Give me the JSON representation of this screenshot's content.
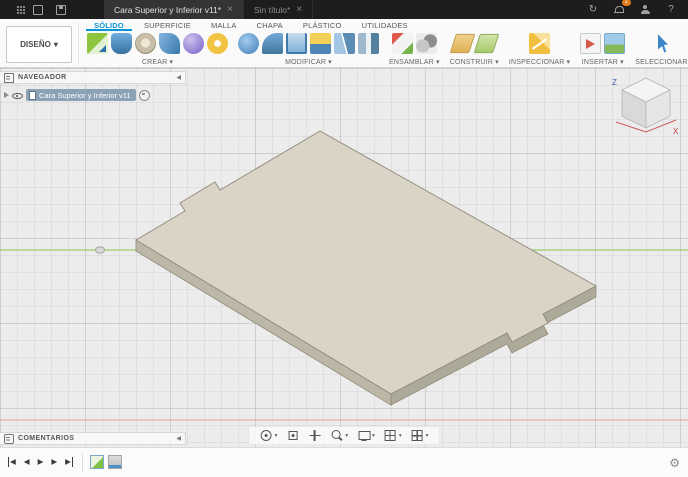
{
  "titlebar": {
    "left_icons": [
      "apps-grid",
      "data-panel",
      "save"
    ],
    "tabs": [
      {
        "label": "Cara Superior y Inferior v11*",
        "active": true
      },
      {
        "label": "Sin título*",
        "active": false
      }
    ],
    "close_symbol": "×",
    "right_icons": [
      {
        "name": "sync-history",
        "symbol": "↻"
      },
      {
        "name": "notifications",
        "symbol": "",
        "badge": "1"
      },
      {
        "name": "profile",
        "symbol": ""
      },
      {
        "name": "help",
        "symbol": "?"
      }
    ]
  },
  "toolbar": {
    "workspace_button": {
      "label": "DISEÑO",
      "arrow": "▾"
    },
    "ribbon_tabs": [
      {
        "label": "SÓLIDO",
        "active": true
      },
      {
        "label": "SUPERFICIE",
        "active": false
      },
      {
        "label": "MALLA",
        "active": false
      },
      {
        "label": "CHAPA",
        "active": false
      },
      {
        "label": "PLÁSTICO",
        "active": false
      },
      {
        "label": "UTILIDADES",
        "active": false
      }
    ],
    "groups": [
      {
        "label": "CREAR",
        "arrow": "▾",
        "icons": [
          "create-sketch",
          "extrude",
          "revolve",
          "sweep",
          "sphere",
          "coil"
        ]
      },
      {
        "label": "MODIFICAR",
        "arrow": "▾",
        "icons": [
          "press-pull",
          "fillet",
          "shell",
          "combine",
          "split-body",
          "align"
        ]
      },
      {
        "label": "ENSAMBLAR",
        "arrow": "▾",
        "icons": [
          "new-component",
          "joint"
        ]
      },
      {
        "label": "CONSTRUIR",
        "arrow": "▾",
        "icons": [
          "offset-plane",
          "axis"
        ]
      },
      {
        "label": "INSPECCIONAR",
        "arrow": "▾",
        "icons": [
          "measure"
        ]
      },
      {
        "label": "INSERTAR",
        "arrow": "▾",
        "icons": [
          "insert-derive",
          "decal"
        ]
      },
      {
        "label": "SELECCIONAR",
        "arrow": "▾",
        "icons": [
          "select"
        ]
      }
    ]
  },
  "navigator": {
    "title": "NAVEGADOR",
    "collapse_symbol": "◀",
    "root_item": {
      "label": "Cara Superior y Inferior v11"
    }
  },
  "comments": {
    "title": "COMENTARIOS",
    "collapse_symbol": "◀"
  },
  "view_nav_toolbar": {
    "arrow": "▾",
    "icons": [
      "orbit",
      "look-at",
      "pan",
      "zoom",
      "display-settings",
      "grid-and-snaps",
      "viewports"
    ]
  },
  "viewcube": {
    "z_label": "Z",
    "x_label": "X"
  },
  "timeline": {
    "controls": [
      {
        "name": "go-to-start",
        "symbol": "◀"
      },
      {
        "name": "step-back",
        "symbol": "◀"
      },
      {
        "name": "play",
        "symbol": "▶"
      },
      {
        "name": "step-forward",
        "symbol": "▶"
      },
      {
        "name": "go-to-end",
        "symbol": "▶"
      }
    ],
    "features": [
      "sketch",
      "body"
    ],
    "settings_symbol": "⚙"
  },
  "scene": {
    "model": "flat rectangular plate with edge tabs, isometric view",
    "colors": {
      "plate_top": "#d9d4c5",
      "plate_side_right": "#aeaa99",
      "plate_side_left": "#bcb7a6",
      "plate_edge": "#8f8a79",
      "y_axis_green": "#9acb67",
      "x_axis_red": "#e89b9b",
      "viewport_bg": "#ececec",
      "fusion_blue": "#0696d7"
    }
  }
}
